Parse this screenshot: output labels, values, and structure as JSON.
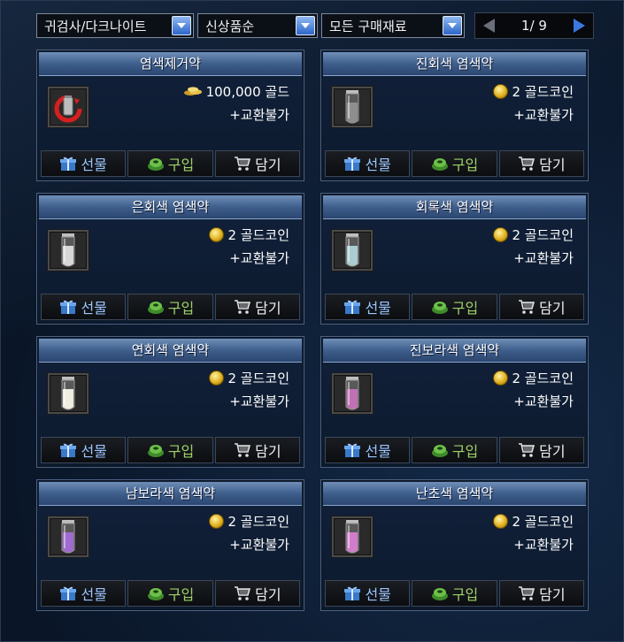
{
  "toolbar": {
    "class_filter": "귀검사/다크나이트",
    "sort_filter": "신상품순",
    "payment_filter": "모든 구매재료",
    "page": "1/ 9"
  },
  "buttons": {
    "gift": "선물",
    "buy": "구입",
    "cart": "담기"
  },
  "items": [
    {
      "name": "염색제거약",
      "price": "100,000 골드",
      "currency": "gold",
      "trade": "+교환불가",
      "icon": "remover-icon",
      "liquid": "#e24040"
    },
    {
      "name": "진회색 염색약",
      "price": "2 골드코인",
      "currency": "coin",
      "trade": "+교환불가",
      "icon": "vial-icon",
      "liquid": "#8e8e8e"
    },
    {
      "name": "은회색 염색약",
      "price": "2 골드코인",
      "currency": "coin",
      "trade": "+교환불가",
      "icon": "vial-icon",
      "liquid": "#d8d8d8"
    },
    {
      "name": "회록색 염색약",
      "price": "2 골드코인",
      "currency": "coin",
      "trade": "+교환불가",
      "icon": "vial-icon",
      "liquid": "#a9cdd0"
    },
    {
      "name": "연회색 염색약",
      "price": "2 골드코인",
      "currency": "coin",
      "trade": "+교환불가",
      "icon": "vial-icon",
      "liquid": "#efece0"
    },
    {
      "name": "진보라색 염색약",
      "price": "2 골드코인",
      "currency": "coin",
      "trade": "+교환불가",
      "icon": "vial-icon",
      "liquid": "#c070b4"
    },
    {
      "name": "남보라색 염색약",
      "price": "2 골드코인",
      "currency": "coin",
      "trade": "+교환불가",
      "icon": "vial-icon",
      "liquid": "#a06ad0"
    },
    {
      "name": "난초색 염색약",
      "price": "2 골드코인",
      "currency": "coin",
      "trade": "+교환불가",
      "icon": "vial-icon",
      "liquid": "#d27ccc"
    }
  ]
}
